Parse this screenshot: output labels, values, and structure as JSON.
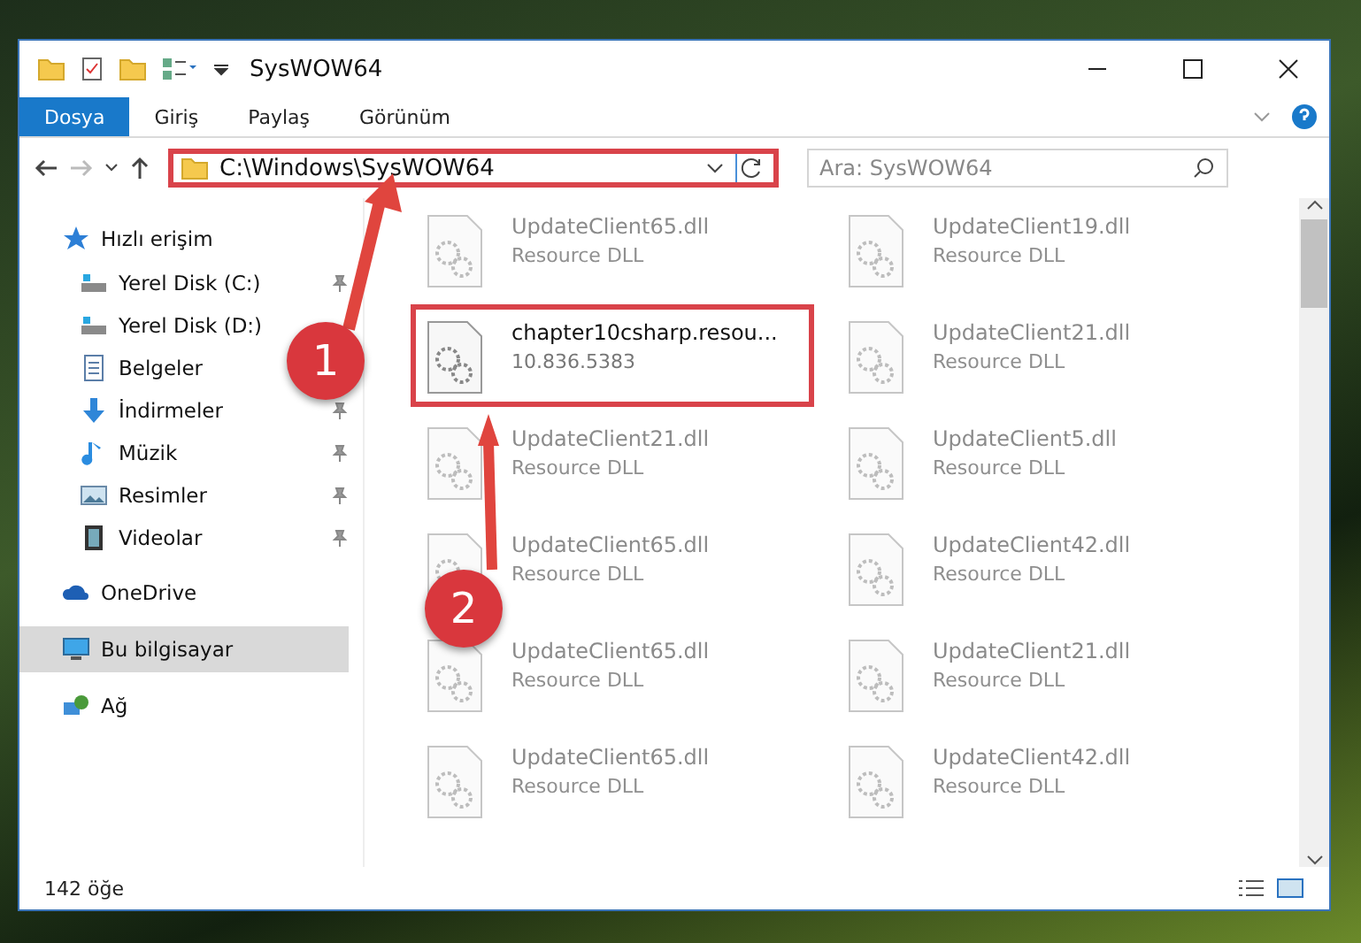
{
  "window": {
    "title": "SysWOW64"
  },
  "ribbon_tabs": [
    {
      "label": "Dosya",
      "selected": true
    },
    {
      "label": "Giriş",
      "selected": false
    },
    {
      "label": "Paylaş",
      "selected": false
    },
    {
      "label": "Görünüm",
      "selected": false
    }
  ],
  "address_bar": {
    "path": "C:\\Windows\\SysWOW64",
    "highlighted": true
  },
  "search": {
    "placeholder": "Ara: SysWOW64"
  },
  "sidebar": {
    "items": [
      {
        "label": "Hızlı erişim",
        "kind": "star",
        "selected": false,
        "children": [
          {
            "label": "Yerel Disk (C:)",
            "kind": "drive",
            "pinned": true,
            "selected": false
          },
          {
            "label": "Yerel Disk (D:)",
            "kind": "drive",
            "pinned": false,
            "selected": false
          },
          {
            "label": "Belgeler",
            "kind": "doc",
            "pinned": false,
            "selected": false
          },
          {
            "label": "İndirmeler",
            "kind": "download",
            "pinned": true,
            "selected": false
          },
          {
            "label": "Müzik",
            "kind": "music",
            "pinned": true,
            "selected": false
          },
          {
            "label": "Resimler",
            "kind": "picture",
            "pinned": true,
            "selected": false
          },
          {
            "label": "Videolar",
            "kind": "film",
            "pinned": true,
            "selected": false
          }
        ]
      },
      {
        "label": "OneDrive",
        "kind": "cloud",
        "selected": false
      },
      {
        "label": "Bu bilgisayar",
        "kind": "pc",
        "selected": true
      },
      {
        "label": "Ağ",
        "kind": "network",
        "selected": false
      }
    ]
  },
  "files": [
    {
      "name": "UpdateClient65.dll",
      "detail": "Resource DLL",
      "selected": false
    },
    {
      "name": "UpdateClient19.dll",
      "detail": "Resource DLL",
      "selected": false
    },
    {
      "name": "chapter10csharp.resou...",
      "detail": "10.836.5383",
      "selected": true
    },
    {
      "name": "UpdateClient21.dll",
      "detail": "Resource DLL",
      "selected": false
    },
    {
      "name": "UpdateClient21.dll",
      "detail": "Resource DLL",
      "selected": false
    },
    {
      "name": "UpdateClient5.dll",
      "detail": "Resource DLL",
      "selected": false
    },
    {
      "name": "UpdateClient65.dll",
      "detail": "Resource DLL",
      "selected": false
    },
    {
      "name": "UpdateClient42.dll",
      "detail": "Resource DLL",
      "selected": false
    },
    {
      "name": "UpdateClient65.dll",
      "detail": "Resource DLL",
      "selected": false
    },
    {
      "name": "UpdateClient21.dll",
      "detail": "Resource DLL",
      "selected": false
    },
    {
      "name": "UpdateClient65.dll",
      "detail": "Resource DLL",
      "selected": false
    },
    {
      "name": "UpdateClient42.dll",
      "detail": "Resource DLL",
      "selected": false
    }
  ],
  "status_bar": {
    "count": "142 öğe"
  },
  "annotations": [
    {
      "number": "1"
    },
    {
      "number": "2"
    }
  ]
}
